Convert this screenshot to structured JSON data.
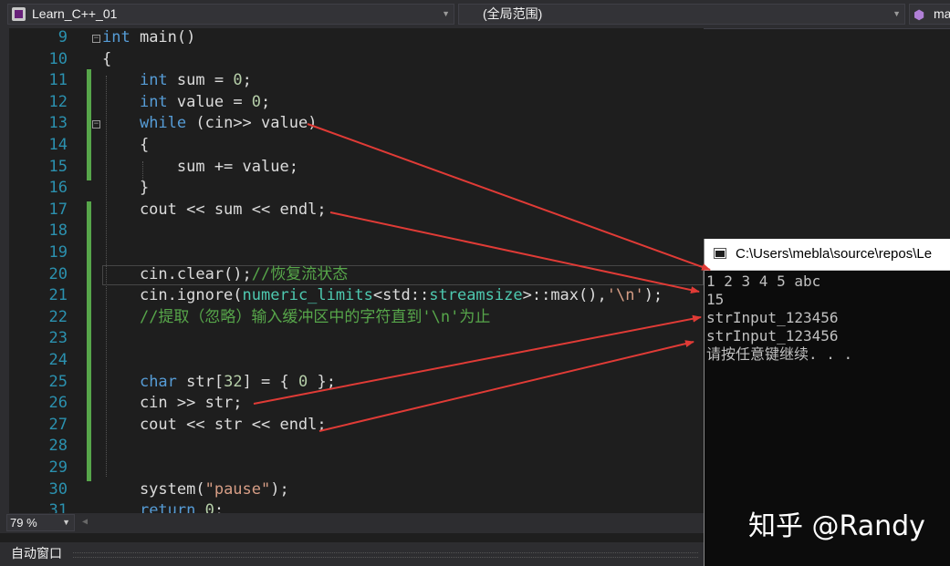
{
  "toolbar": {
    "project": "Learn_C++_01",
    "scope": "(全局范围)",
    "member": "ma"
  },
  "editor": {
    "lines": [
      {
        "n": "9",
        "t": [
          {
            "c": "kw",
            "v": "int"
          },
          {
            "v": " main()"
          }
        ]
      },
      {
        "n": "10",
        "t": [
          {
            "v": "{"
          }
        ]
      },
      {
        "n": "11",
        "t": [
          {
            "v": "    "
          },
          {
            "c": "kw",
            "v": "int"
          },
          {
            "v": " sum = "
          },
          {
            "c": "num",
            "v": "0"
          },
          {
            "v": ";"
          }
        ]
      },
      {
        "n": "12",
        "t": [
          {
            "v": "    "
          },
          {
            "c": "kw",
            "v": "int"
          },
          {
            "v": " value = "
          },
          {
            "c": "num",
            "v": "0"
          },
          {
            "v": ";"
          }
        ]
      },
      {
        "n": "13",
        "t": [
          {
            "v": "    "
          },
          {
            "c": "kw",
            "v": "while"
          },
          {
            "v": " (cin>> value)"
          }
        ]
      },
      {
        "n": "14",
        "t": [
          {
            "v": "    {"
          }
        ]
      },
      {
        "n": "15",
        "t": [
          {
            "v": "        sum += value;"
          }
        ]
      },
      {
        "n": "16",
        "t": [
          {
            "v": "    }"
          }
        ]
      },
      {
        "n": "17",
        "t": [
          {
            "v": "    cout << sum << endl;"
          }
        ]
      },
      {
        "n": "18",
        "t": []
      },
      {
        "n": "19",
        "t": []
      },
      {
        "n": "20",
        "t": [
          {
            "v": "    cin.clear();"
          },
          {
            "c": "cm",
            "v": "//恢复流状态"
          }
        ]
      },
      {
        "n": "21",
        "t": [
          {
            "v": "    cin.ignore("
          },
          {
            "c": "ty",
            "v": "numeric_limits"
          },
          {
            "v": "<std::"
          },
          {
            "c": "ty",
            "v": "streamsize"
          },
          {
            "v": ">::max(),"
          },
          {
            "c": "str",
            "v": "'\\n'"
          },
          {
            "v": ");"
          }
        ]
      },
      {
        "n": "22",
        "t": [
          {
            "v": "    "
          },
          {
            "c": "cm",
            "v": "//提取（忽略）输入缓冲区中的字符直到'\\n'为止"
          }
        ]
      },
      {
        "n": "23",
        "t": []
      },
      {
        "n": "24",
        "t": []
      },
      {
        "n": "25",
        "t": [
          {
            "v": "    "
          },
          {
            "c": "kw",
            "v": "char"
          },
          {
            "v": " str["
          },
          {
            "c": "num",
            "v": "32"
          },
          {
            "v": "] = { "
          },
          {
            "c": "num",
            "v": "0"
          },
          {
            "v": " };"
          }
        ]
      },
      {
        "n": "26",
        "t": [
          {
            "v": "    cin >> str;"
          }
        ]
      },
      {
        "n": "27",
        "t": [
          {
            "v": "    cout << str << endl;"
          }
        ]
      },
      {
        "n": "28",
        "t": []
      },
      {
        "n": "29",
        "t": []
      },
      {
        "n": "30",
        "t": [
          {
            "v": "    system("
          },
          {
            "c": "str",
            "v": "\"pause\""
          },
          {
            "v": ");"
          }
        ]
      },
      {
        "n": "31",
        "t": [
          {
            "v": "    "
          },
          {
            "c": "kw",
            "v": "return"
          },
          {
            "v": " "
          },
          {
            "c": "num",
            "v": "0"
          },
          {
            "v": ";"
          }
        ]
      }
    ]
  },
  "status": {
    "zoom": "79 %",
    "auto_window": "自动窗口"
  },
  "console": {
    "title": "C:\\Users\\mebla\\source\\repos\\Le",
    "lines": [
      "1 2 3 4 5 abc",
      "15",
      "strInput_123456",
      "strInput_123456",
      "请按任意键继续. . ."
    ]
  },
  "watermark": "知乎 @Randy",
  "colors": {
    "arrow": "#e03b36",
    "keyword": "#569cd6",
    "comment": "#57a64a",
    "type": "#4ec9b0",
    "string": "#d69d85",
    "number": "#b5cea8"
  }
}
